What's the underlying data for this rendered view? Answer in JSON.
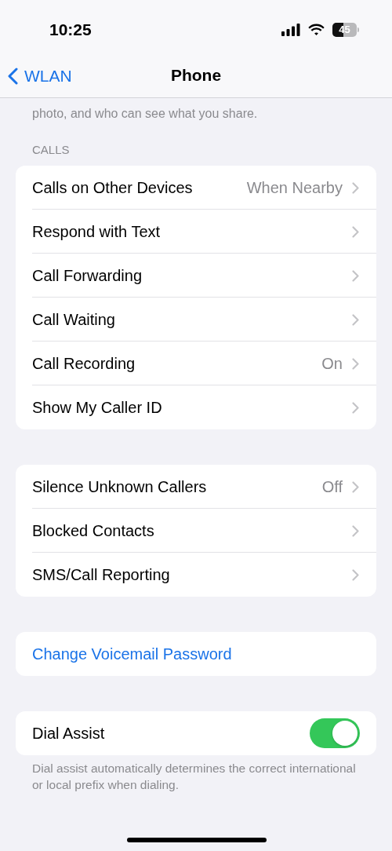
{
  "status_bar": {
    "time": "10:25",
    "battery": "45"
  },
  "nav": {
    "back": "WLAN",
    "title": "Phone"
  },
  "intro": "photo, and who can see what you share.",
  "sections": [
    {
      "header": "CALLS",
      "rows": [
        {
          "kind": "link",
          "label": "Calls on Other Devices",
          "value": "When Nearby"
        },
        {
          "kind": "link",
          "label": "Respond with Text"
        },
        {
          "kind": "link",
          "label": "Call Forwarding"
        },
        {
          "kind": "link",
          "label": "Call Waiting"
        },
        {
          "kind": "link",
          "label": "Call Recording",
          "value": "On"
        },
        {
          "kind": "link",
          "label": "Show My Caller ID"
        }
      ]
    },
    {
      "rows": [
        {
          "kind": "link",
          "label": "Silence Unknown Callers",
          "value": "Off"
        },
        {
          "kind": "link",
          "label": "Blocked Contacts"
        },
        {
          "kind": "link",
          "label": "SMS/Call Reporting"
        }
      ]
    },
    {
      "rows": [
        {
          "kind": "action",
          "label": "Change Voicemail Password"
        }
      ]
    },
    {
      "rows": [
        {
          "kind": "toggle",
          "label": "Dial Assist",
          "on": true
        }
      ],
      "footer": "Dial assist automatically determines the correct international or local prefix when dialing."
    }
  ]
}
